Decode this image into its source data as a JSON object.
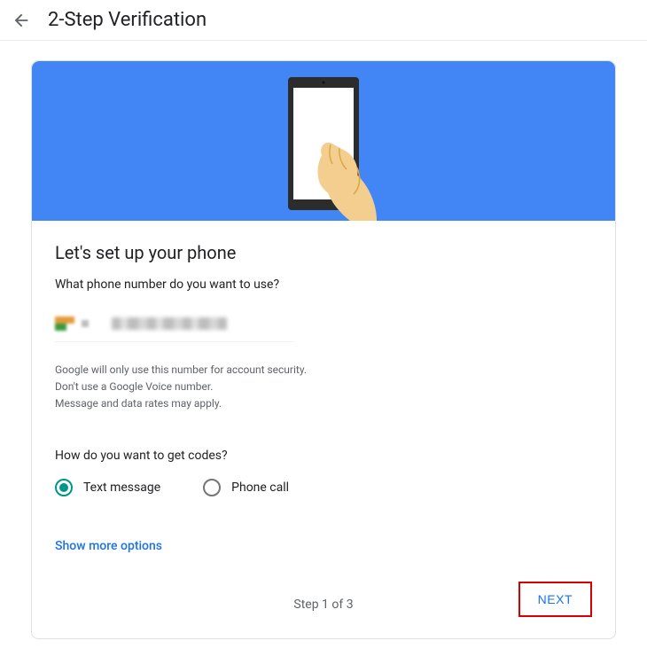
{
  "header": {
    "title": "2-Step Verification"
  },
  "main": {
    "heading": "Let's set up your phone",
    "question": "What phone number do you want to use?",
    "disclaimer_line1": "Google will only use this number for account security.",
    "disclaimer_line2": "Don't use a Google Voice number.",
    "disclaimer_line3": "Message and data rates may apply.",
    "codes_question": "How do you want to get codes?",
    "radios": [
      {
        "label": "Text message",
        "selected": true
      },
      {
        "label": "Phone call",
        "selected": false
      }
    ],
    "show_more": "Show more options",
    "step_text": "Step 1 of 3",
    "next": "NEXT"
  }
}
